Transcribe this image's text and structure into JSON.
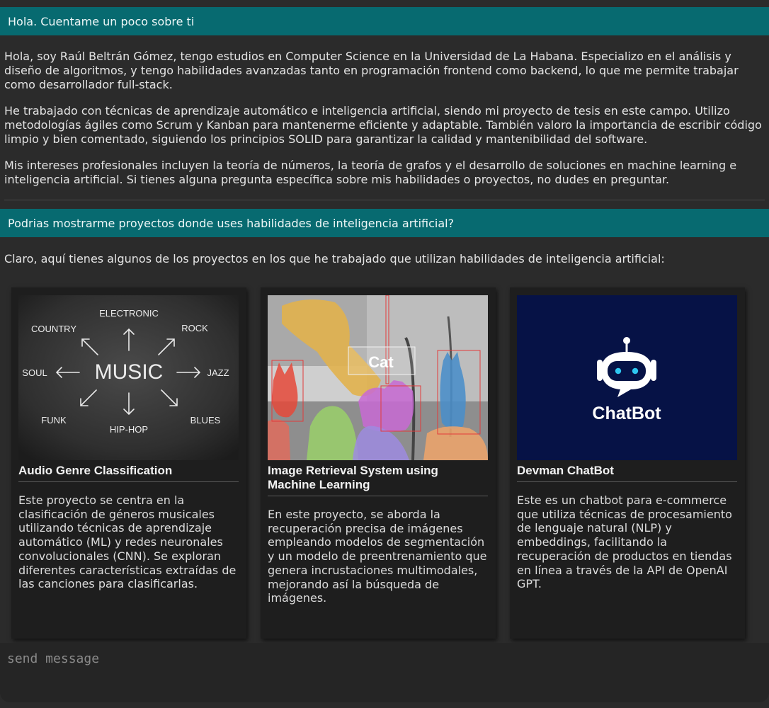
{
  "conversation": {
    "question_1": "Hola. Cuentame un poco sobre ti",
    "answer_1": [
      "Hola, soy Raúl Beltrán Gómez, tengo estudios en Computer Science en la Universidad de La Habana. Especializo en el análisis y diseño de algoritmos, y tengo habilidades avanzadas tanto en programación frontend como backend, lo que me permite trabajar como desarrollador full-stack.",
      "He trabajado con técnicas de aprendizaje automático e inteligencia artificial, siendo mi proyecto de tesis en este campo. Utilizo metodologías ágiles como Scrum y Kanban para mantenerme eficiente y adaptable. También valoro la importancia de escribir código limpio y bien comentado, siguiendo los principios SOLID para garantizar la calidad y mantenibilidad del software.",
      "Mis intereses profesionales incluyen la teoría de números, la teoría de grafos y el desarrollo de soluciones en machine learning e inteligencia artificial. Si tienes alguna pregunta específica sobre mis habilidades o proyectos, no dudes en preguntar."
    ],
    "question_2": "Podrias mostrarme proyectos donde uses habilidades de inteligencia artificial?",
    "answer_2": "Claro, aquí tienes algunos de los proyectos en los que he trabajado que utilizan habilidades de inteligencia artificial:"
  },
  "projects": [
    {
      "title": "Audio Genre Classification",
      "description": "Este proyecto se centra en la clasificación de géneros musicales utilizando técnicas de aprendizaje automático (ML) y redes neuronales convolucionales (CNN). Se exploran diferentes características extraídas de las canciones para clasificarlas.",
      "image": {
        "center": "MUSIC",
        "genres": [
          "ELECTRONIC",
          "COUNTRY",
          "ROCK",
          "SOUL",
          "JAZZ",
          "FUNK",
          "HIP-HOP",
          "BLUES"
        ]
      }
    },
    {
      "title": "Image Retrieval System using Machine Learning",
      "description": "En este proyecto, se aborda la recuperación precisa de imágenes empleando modelos de segmentación y un modelo de preentrenamiento que genera incrustaciones multimodales, mejorando así la búsqueda de imágenes.",
      "image": {
        "label": "Cat"
      }
    },
    {
      "title": "Devman ChatBot",
      "description": "Este es un chatbot para e-commerce que utiliza técnicas de procesamiento de lenguaje natural (NLP) y embeddings, facilitando la recuperación de productos en tiendas en línea a través de la API de OpenAI GPT.",
      "image": {
        "wordmark": "ChatBot",
        "icon": "robot-chat-icon"
      }
    }
  ],
  "composer": {
    "placeholder": "send message"
  },
  "colors": {
    "background": "#2b2b2b",
    "user_bar": "#076a70",
    "card": "#1e1e1e",
    "chatbot_bg": "#061246",
    "robot_eyes": "#2ec7f0"
  }
}
